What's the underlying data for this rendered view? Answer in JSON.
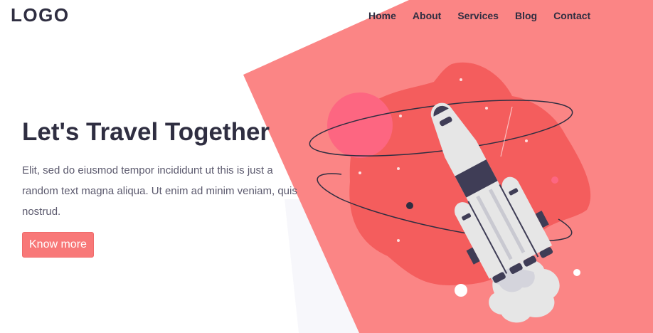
{
  "header": {
    "logo": "LOGO",
    "nav": [
      {
        "label": "Home"
      },
      {
        "label": "About"
      },
      {
        "label": "Services"
      },
      {
        "label": "Blog"
      },
      {
        "label": "Contact"
      }
    ]
  },
  "hero": {
    "title": "Let's Travel Together",
    "description": "Elit, sed do eiusmod tempor incididunt ut this is just a random text magna aliqua. Ut enim ad minim veniam, quis nostrud.",
    "cta_label": "Know more"
  },
  "colors": {
    "accent": "#fb8585",
    "blob": "#f45d5d",
    "planet": "#fd6681",
    "text": "#2f2e41"
  },
  "illustration": {
    "icon": "rocket-launch-illustration"
  }
}
